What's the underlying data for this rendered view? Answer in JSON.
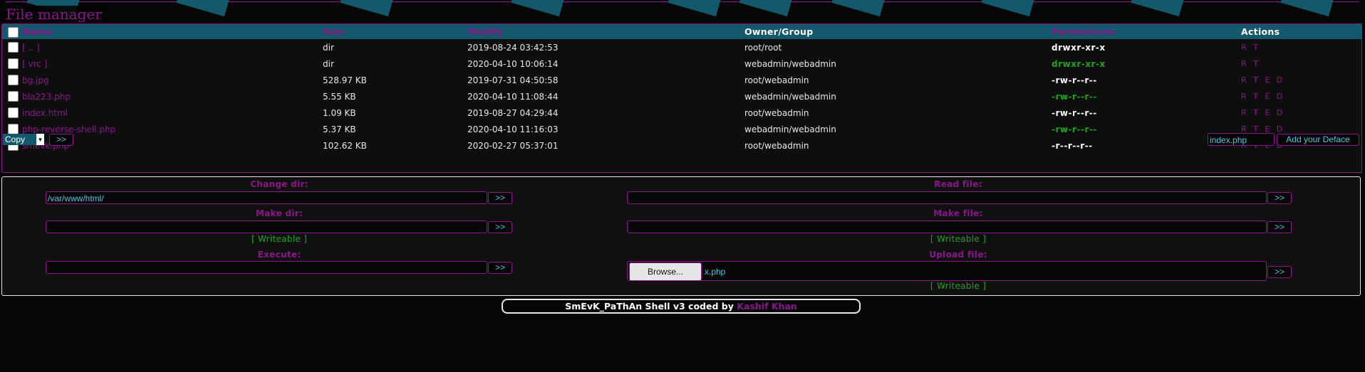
{
  "header": {
    "title": "File manager"
  },
  "columns": [
    "Name",
    "Size",
    "Modify",
    "Owner/Group",
    "Permissions",
    "Actions"
  ],
  "files": [
    {
      "name": "[ .. ]",
      "size": "dir",
      "modify": "2019-08-24 03:42:53",
      "owner": "root/root",
      "perm": "drwxr-xr-x",
      "perm_color": "#ffffff",
      "actions": "R T"
    },
    {
      "name": "[ vrc ]",
      "size": "dir",
      "modify": "2020-04-10 10:06:14",
      "owner": "webadmin/webadmin",
      "perm": "drwxr-xr-x",
      "perm_color": "#1fa31f",
      "actions": "R T"
    },
    {
      "name": "bg.jpg",
      "size": "528.97 KB",
      "modify": "2019-07-31 04:50:58",
      "owner": "root/webadmin",
      "perm": "-rw-r--r--",
      "perm_color": "#ffffff",
      "actions": "R T E D"
    },
    {
      "name": "bla223.php",
      "size": "5.55 KB",
      "modify": "2020-04-10 11:08:44",
      "owner": "webadmin/webadmin",
      "perm": "-rw-r--r--",
      "perm_color": "#1fa31f",
      "actions": "R T E D"
    },
    {
      "name": "index.html",
      "size": "1.09 KB",
      "modify": "2019-08-27 04:29:44",
      "owner": "root/webadmin",
      "perm": "-rw-r--r--",
      "perm_color": "#ffffff",
      "actions": "R T E D"
    },
    {
      "name": "php-reverse-shell.php",
      "size": "5.37 KB",
      "modify": "2020-04-10 11:16:03",
      "owner": "webadmin/webadmin",
      "perm": "-rw-r--r--",
      "perm_color": "#1fa31f",
      "actions": "R T E D"
    },
    {
      "name": "smevk.php",
      "size": "102.62 KB",
      "modify": "2020-02-27 05:37:01",
      "owner": "root/webadmin",
      "perm": "-r--r--r--",
      "perm_color": "#ffffff",
      "actions": "R T E D"
    }
  ],
  "bulk": {
    "select_value": "Copy",
    "go_label": ">>"
  },
  "deface": {
    "file_value": "index.php",
    "button_label": "Add your Deface"
  },
  "tools": {
    "change_dir": {
      "label": "Change dir:",
      "value": "/var/www/html/",
      "go": ">>"
    },
    "make_dir": {
      "label": "Make dir:",
      "value": "",
      "go": ">>",
      "status": "[ Writeable ]"
    },
    "execute": {
      "label": "Execute:",
      "value": "",
      "go": ">>"
    },
    "read_file": {
      "label": "Read file:",
      "value": "",
      "go": ">>"
    },
    "make_file": {
      "label": "Make file:",
      "value": "",
      "go": ">>",
      "status": "[ Writeable ]"
    },
    "upload_file": {
      "label": "Upload file:",
      "browse": "Browse...",
      "filename": "x.php",
      "go": ">>",
      "status": "[ Writeable ]"
    }
  },
  "footer": {
    "text": "SmEvK_PaThAn Shell v3 coded by",
    "author": "Kashif Khan"
  },
  "colors": {
    "accent": "#8a168a",
    "header_bg": "#13586b",
    "writeable": "#1fa31f",
    "input_text": "#4fc3e0"
  }
}
